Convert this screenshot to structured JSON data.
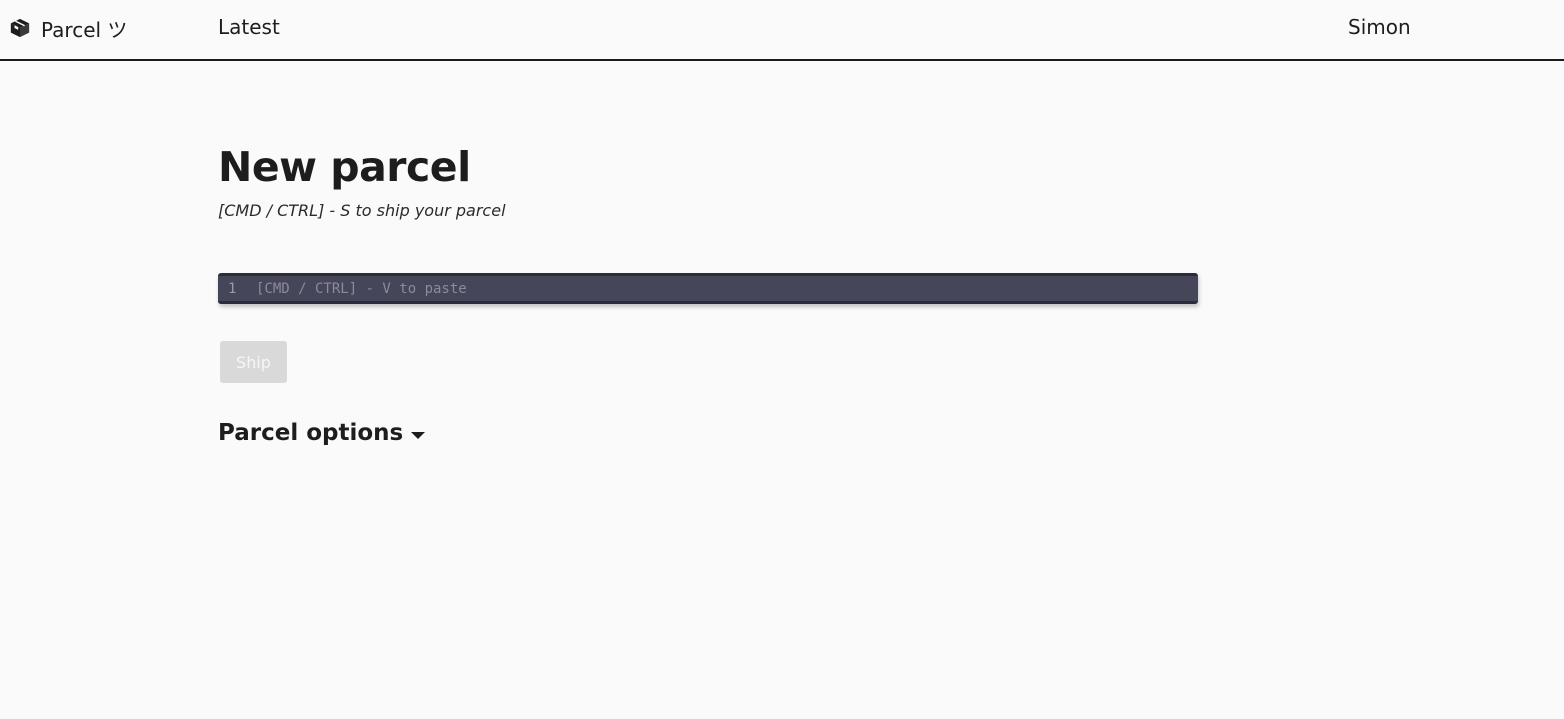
{
  "header": {
    "brand": {
      "icon": "package-icon",
      "label": "Parcel ツ"
    },
    "nav_latest": "Latest",
    "user": "Simon"
  },
  "main": {
    "title": "New parcel",
    "subtitle": "[CMD / CTRL] - S to ship your parcel",
    "editor": {
      "line_number": "1",
      "placeholder": "[CMD / CTRL] - V to paste"
    },
    "ship_button": {
      "label": "Ship",
      "disabled": true
    },
    "options": {
      "label": "Parcel options",
      "icon": "caret-down-icon"
    }
  },
  "colors": {
    "background": "#fafafa",
    "text": "#1d1d1d",
    "editor_bg": "#454659",
    "editor_border": "#2b2c39",
    "button_disabled": "#d9d9d9"
  }
}
